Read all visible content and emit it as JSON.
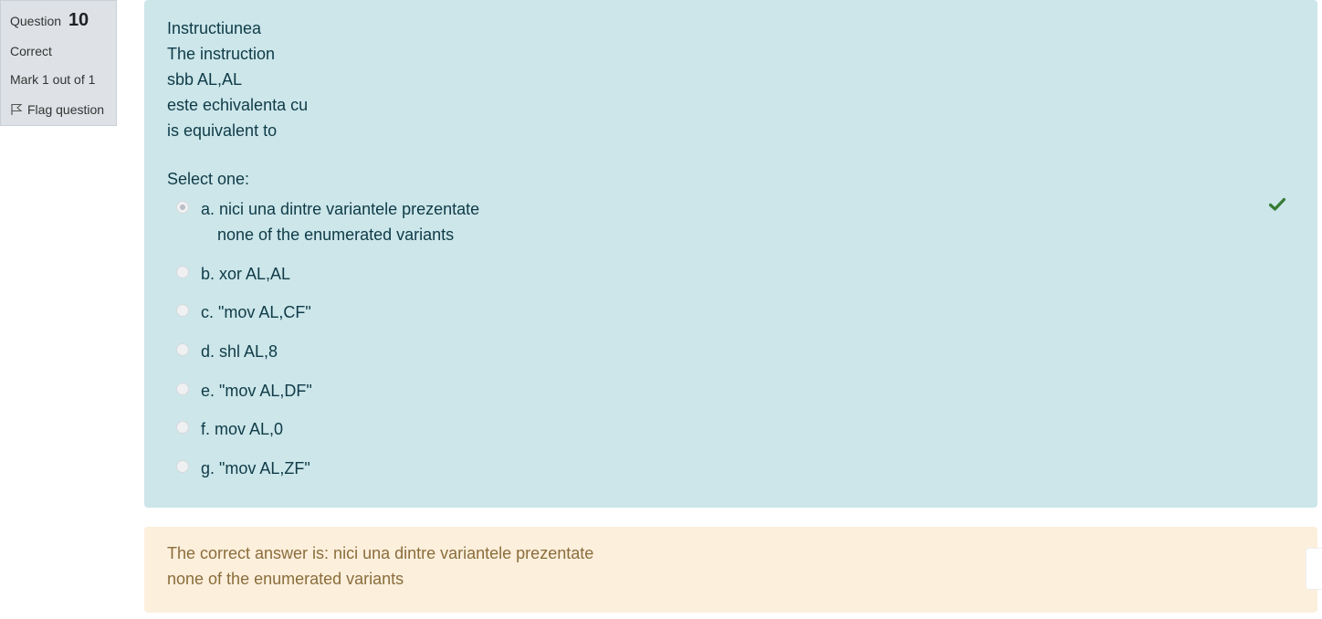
{
  "info": {
    "question_label": "Question",
    "question_number": "10",
    "state": "Correct",
    "grade": "Mark 1 out of 1",
    "flag_label": "Flag question"
  },
  "question": {
    "text_lines": [
      "Instructiunea",
      "The instruction",
      "sbb AL,AL",
      "este echivalenta cu",
      "is equivalent to"
    ],
    "prompt": "Select one:",
    "answers": [
      {
        "line1": "a. nici una dintre variantele prezentate",
        "line2": "none of the enumerated variants",
        "checked": true,
        "correct": true
      },
      {
        "line1": "b. xor AL,AL",
        "line2": "",
        "checked": false
      },
      {
        "line1": "c. \"mov AL,CF\"",
        "line2": "",
        "checked": false
      },
      {
        "line1": "d. shl AL,8",
        "line2": "",
        "checked": false
      },
      {
        "line1": "e. \"mov AL,DF\"",
        "line2": "",
        "checked": false
      },
      {
        "line1": "f. mov AL,0",
        "line2": "",
        "checked": false
      },
      {
        "line1": "g. \"mov AL,ZF\"",
        "line2": "",
        "checked": false
      }
    ],
    "correct_icon": "check-icon"
  },
  "feedback": {
    "right_answer_line1": "The correct answer is: nici una dintre variantele prezentate",
    "right_answer_line2": "none of the enumerated variants"
  },
  "colors": {
    "formulation_bg": "#cce6ea",
    "feedback_bg": "#fcefdc",
    "info_bg": "#dee2e6",
    "check_green": "#357a32"
  }
}
